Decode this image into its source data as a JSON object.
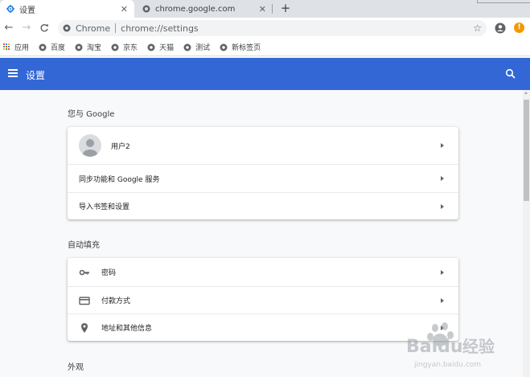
{
  "tabs": [
    {
      "title": "设置",
      "active": true
    },
    {
      "title": "chrome.google.com",
      "active": false
    }
  ],
  "toolbar": {
    "origin_label": "Chrome",
    "url": "chrome://settings"
  },
  "bookmarks": {
    "apps_label": "应用",
    "items": [
      "百度",
      "淘宝",
      "京东",
      "天猫",
      "测试",
      "新标签页"
    ]
  },
  "header": {
    "title": "设置",
    "color": "#3367d6"
  },
  "sections": {
    "you_and_google": {
      "title": "您与 Google",
      "user": "用户2",
      "sync": "同步功能和 Google 服务",
      "import": "导入书签和设置"
    },
    "autofill": {
      "title": "自动填充",
      "passwords": "密码",
      "payment": "付款方式",
      "addresses": "地址和其他信息"
    },
    "appearance": {
      "title": "外观"
    }
  },
  "alert_badge": "!",
  "colors": {
    "accent": "#3367d6",
    "alert": "#f29900"
  }
}
